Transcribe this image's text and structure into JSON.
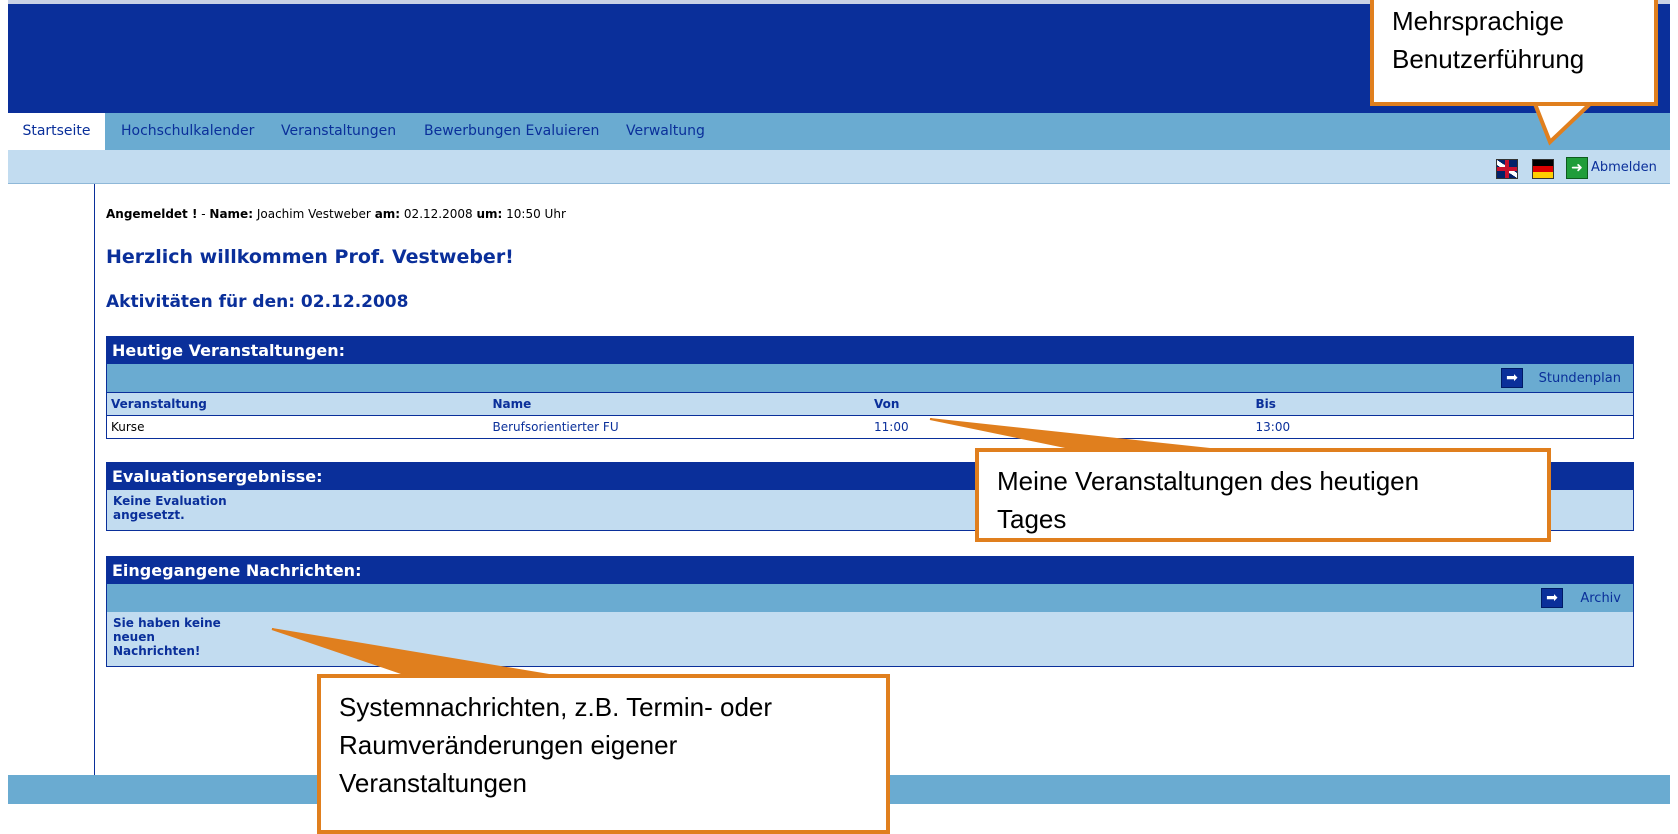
{
  "nav": {
    "tabs": [
      "Startseite",
      "Hochschulkalender",
      "Veranstaltungen",
      "Bewerbungen Evaluieren",
      "Verwaltung"
    ],
    "active": "Startseite"
  },
  "subbar": {
    "logout_label": "Abmelden",
    "flags": [
      "flag-uk-icon",
      "flag-de-icon",
      "exit-icon"
    ]
  },
  "login_line": {
    "status": "Angemeldet !",
    "dash": " - ",
    "name_label": "Name:",
    "name": "Joachim Vestweber",
    "date_label": "am:",
    "date": "02.12.2008",
    "time_label": "um:",
    "time": "10:50 Uhr"
  },
  "welcome": "Herzlich willkommen Prof. Vestweber!",
  "activities": "Aktivitäten für den: 02.12.2008",
  "today_courses": {
    "title": "Heutige Veranstaltungen:",
    "link": "Stundenplan",
    "columns": [
      "Veranstaltung",
      "Name",
      "Von",
      "Bis"
    ],
    "rows": [
      [
        "Kurse",
        "Berufsorientierter FU",
        "11:00",
        "13:00"
      ]
    ]
  },
  "evaluation": {
    "title": "Evaluationsergebnisse:",
    "text_line1": "Keine Evaluation",
    "text_line2": "angesetzt."
  },
  "messages": {
    "title": "Eingegangene Nachrichten:",
    "link": "Archiv",
    "line1": "Sie haben keine",
    "line2": "neuen",
    "line3": "Nachrichten!"
  },
  "callouts": {
    "languages_line1": "Mehrsprachige",
    "languages_line2": "Benutzerführung",
    "courses_line1": "Meine Veranstaltungen des heutigen",
    "courses_line2": "Tages",
    "messages_line1": "Systemnachrichten, z.B. Termin- oder",
    "messages_line2": "Raumveränderungen eigener",
    "messages_line3": "Veranstaltungen"
  },
  "colors": {
    "dark_blue": "#0a2f9a",
    "mid_blue": "#6aabd1",
    "light_blue": "#c2dcf0",
    "callout_orange": "#e07f1e"
  }
}
